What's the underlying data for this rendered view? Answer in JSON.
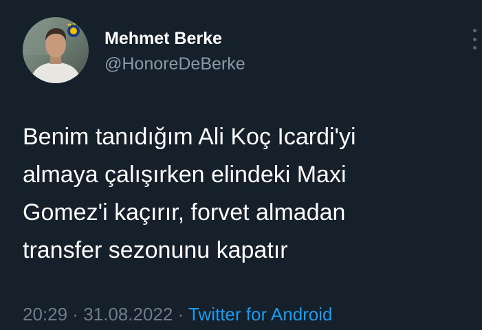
{
  "tweet": {
    "author": {
      "display_name": "Mehmet Berke",
      "handle": "@HonoreDeBerke",
      "avatar_icon": "profile-photo-avatar"
    },
    "more_icon": "more-options-icon",
    "text_lines": [
      "Benim tanıdığım Ali Koç Icardi'yi",
      "almaya çalışırken elindeki Maxi",
      "Gomez'i kaçırır, forvet almadan",
      "transfer sezonunu kapatır"
    ],
    "time": "20:29",
    "separator_1": " · ",
    "date": "31.08.2022",
    "separator_2": " · ",
    "source": "Twitter for Android"
  },
  "colors": {
    "background": "#15202b",
    "text": "#ffffff",
    "secondary_text": "#8b98a5",
    "link": "#1d9bf0"
  }
}
